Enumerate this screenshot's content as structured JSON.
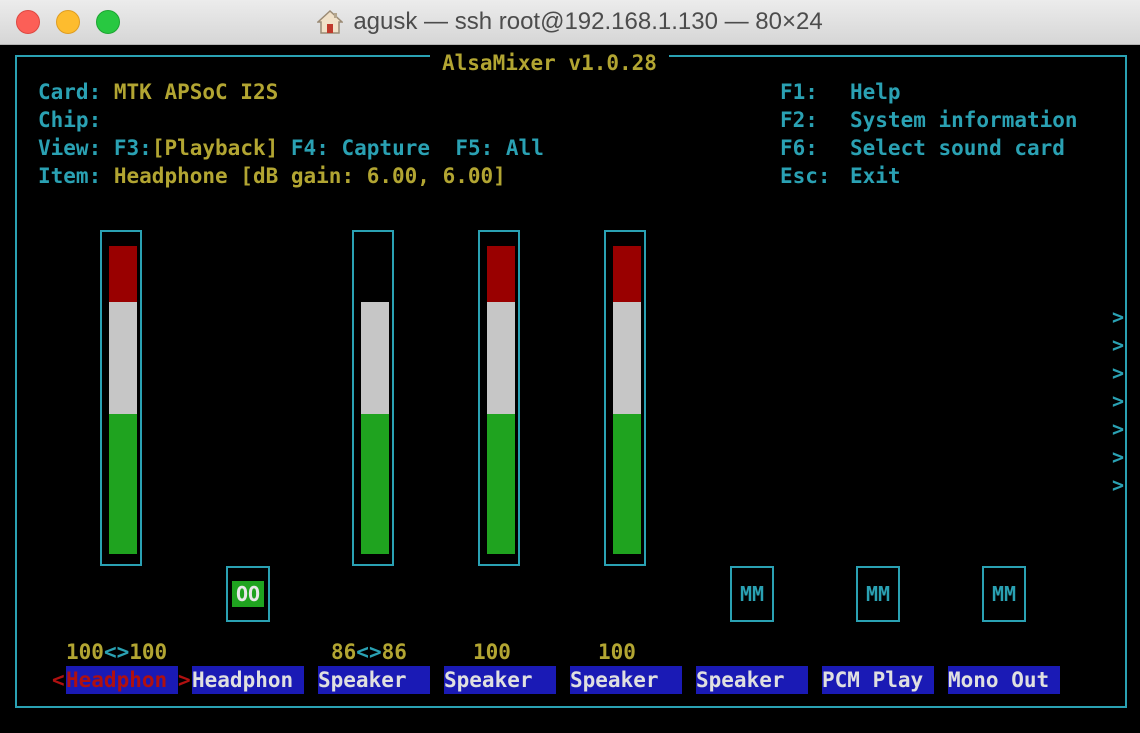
{
  "window": {
    "title": "agusk — ssh root@192.168.1.130 — 80×24",
    "home_icon": "home-icon"
  },
  "mixer": {
    "title": "AlsaMixer v1.0.28",
    "info": {
      "card_label": "Card:",
      "card_value": "MTK APSoC I2S",
      "chip_label": "Chip:",
      "chip_value": "",
      "view_label": "View:",
      "view_f3_key": "F3:",
      "view_f3_value": "[Playback]",
      "view_f4_key": "F4:",
      "view_f4_value": "Capture",
      "view_f5_key": "F5:",
      "view_f5_value": "All",
      "item_label": "Item:",
      "item_value": "Headphone [dB gain: 6.00, 6.00]"
    },
    "keys": [
      {
        "key": "F1:",
        "action": "Help"
      },
      {
        "key": "F2:",
        "action": "System information"
      },
      {
        "key": "F6:",
        "action": "Select sound card"
      },
      {
        "key": "Esc:",
        "action": "Exit"
      }
    ],
    "channels": [
      {
        "label": "Headphon",
        "selected": true,
        "volume_left": "100",
        "volume_sep": "<>",
        "volume_right": "100",
        "level": 1.0
      },
      {
        "label": "Headphon",
        "selected": false,
        "switch": "OO"
      },
      {
        "label": "Speaker",
        "selected": false,
        "volume_left": "86",
        "volume_sep": "<>",
        "volume_right": "86",
        "level": 0.86
      },
      {
        "label": "Speaker",
        "selected": false,
        "volume": "100",
        "level": 1.0
      },
      {
        "label": "Speaker",
        "selected": false,
        "volume": "100",
        "level": 1.0
      },
      {
        "label": "Speaker",
        "selected": false,
        "switch": "MM"
      },
      {
        "label": "PCM Play",
        "selected": false,
        "switch": "MM"
      },
      {
        "label": "Mono Out",
        "selected": false,
        "switch": "MM"
      }
    ],
    "selection_arrows": {
      "left": "<",
      "right": ">"
    },
    "scroll_indicator": [
      ">",
      ">",
      ">",
      ">",
      ">",
      ">",
      ">"
    ],
    "colors": {
      "border": "#2aa1b3",
      "text_yellow": "#b2a532",
      "bar_red": "#990000",
      "bar_white": "#c6c6c6",
      "bar_green": "#1fa31f",
      "label_bg": "#1a1ab5",
      "selected_red": "#b01010"
    }
  }
}
